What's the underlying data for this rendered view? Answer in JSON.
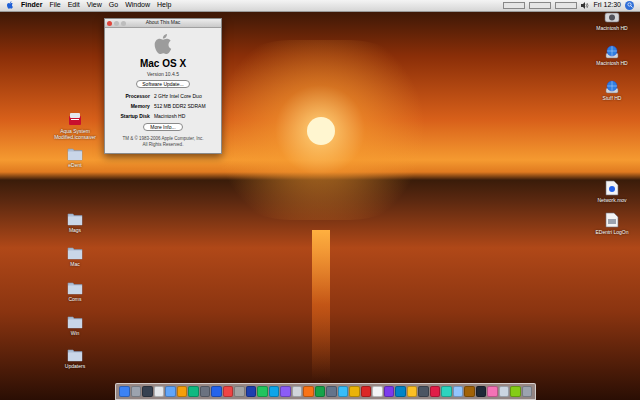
{
  "menu_bar": {
    "menus": [
      {
        "label": "Finder",
        "selected": false
      },
      {
        "label": "File",
        "selected": false
      },
      {
        "label": "Edit",
        "selected": false
      },
      {
        "label": "View",
        "selected": false
      },
      {
        "label": "Go",
        "selected": false
      },
      {
        "label": "Window",
        "selected": false
      },
      {
        "label": "Help",
        "selected": false
      }
    ],
    "clock": "Fri 12:30"
  },
  "about_window": {
    "title": "About This Mac",
    "product": "Mac OS X",
    "version": "Version 10.4.5",
    "buttons": [
      "Software Update...",
      "More Info..."
    ],
    "specs": [
      {
        "label": "Processor",
        "value": "2 GHz Intel Core Duo"
      },
      {
        "label": "Memory",
        "value": "512 MB DDR2 SDRAM"
      },
      {
        "label": "Startup Disk",
        "value": "Macintosh HD"
      }
    ],
    "copyright": [
      "TM & © 1983-2006 Apple Computer, Inc.",
      "All Rights Reserved."
    ]
  },
  "left_icons": [
    {
      "label": "Aqua System Modified.iconsaver",
      "kind": "app"
    },
    {
      "label": "eDent",
      "kind": "folder"
    },
    {
      "label": "Mags",
      "kind": "folder"
    },
    {
      "label": "Mac",
      "kind": "folder"
    },
    {
      "label": "Coms",
      "kind": "folder"
    },
    {
      "label": "Win",
      "kind": "folder"
    },
    {
      "label": "Updaters",
      "kind": "folder"
    }
  ],
  "right_icons": [
    {
      "label": "Macintosh HD",
      "kind": "disk"
    },
    {
      "label": "Macintosh HD",
      "kind": "globe"
    },
    {
      "label": "Stuff HD",
      "kind": "globe"
    },
    {
      "label": "Network.mov",
      "kind": "movie"
    },
    {
      "label": "EDentri LogOn",
      "kind": "file"
    }
  ],
  "dock": [
    {
      "color": "#3b82f6"
    },
    {
      "color": "#9ca3af"
    },
    {
      "color": "#374151"
    },
    {
      "color": "#e5e7eb"
    },
    {
      "color": "#60a5fa"
    },
    {
      "color": "#f59e0b"
    },
    {
      "color": "#10b981"
    },
    {
      "color": "#6b7280"
    },
    {
      "color": "#2563eb"
    },
    {
      "color": "#ef4444"
    },
    {
      "color": "#a3a3a3"
    },
    {
      "color": "#1e40af"
    },
    {
      "color": "#22c55e"
    },
    {
      "color": "#0ea5e9"
    },
    {
      "color": "#8b5cf6"
    },
    {
      "color": "#d1d5db"
    },
    {
      "color": "#f97316"
    },
    {
      "color": "#16a34a"
    },
    {
      "color": "#64748b"
    },
    {
      "color": "#38bdf8"
    },
    {
      "color": "#eab308"
    },
    {
      "color": "#dc2626"
    },
    {
      "color": "#f3f4f6"
    },
    {
      "color": "#7c3aed"
    },
    {
      "color": "#0284c7"
    },
    {
      "color": "#fbbf24"
    },
    {
      "color": "#4b5563"
    },
    {
      "color": "#e11d48"
    },
    {
      "color": "#2dd4bf"
    },
    {
      "color": "#93c5fd"
    },
    {
      "color": "#a16207"
    },
    {
      "color": "#1f2937"
    },
    {
      "color": "#f472b6"
    },
    {
      "color": "#cbd5e1"
    },
    {
      "color": "#84cc16"
    },
    {
      "color": "#9ca3af"
    }
  ]
}
